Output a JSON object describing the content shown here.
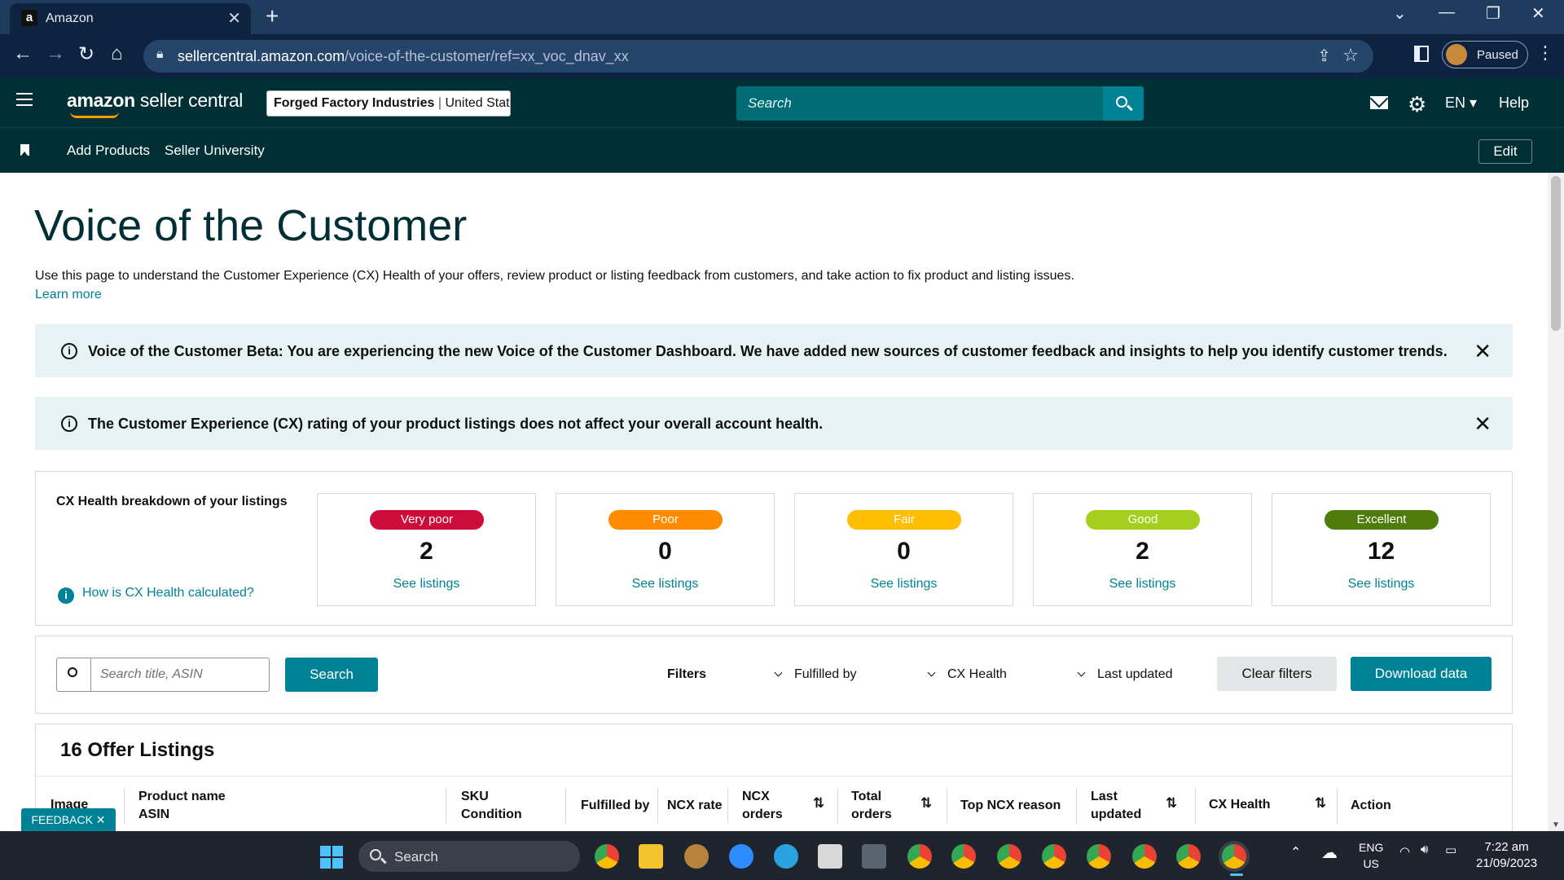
{
  "browser": {
    "tab_title": "Amazon",
    "tab_favicon": "a",
    "url_host": "sellercentral.amazon.com",
    "url_path": "/voice-of-the-customer/ref=xx_voc_dnav_xx",
    "profile_status": "Paused"
  },
  "header": {
    "logo_brand": "amazon",
    "logo_product": " seller central",
    "store_name": "Forged Factory Industries",
    "store_region": "United States",
    "search_placeholder": "Search",
    "language": "EN",
    "help_label": "Help"
  },
  "subnav": {
    "links": [
      "Add Products",
      "Seller University"
    ],
    "edit_label": "Edit"
  },
  "page": {
    "title": "Voice of the Customer",
    "description": "Use this page to understand the Customer Experience (CX) Health of your offers, review product or listing feedback from customers, and take action to fix product and listing issues.",
    "learn_more": "Learn more"
  },
  "alerts": [
    {
      "text": "Voice of the Customer Beta: You are experiencing the new Voice of the Customer Dashboard. We have added new sources of customer feedback and insights to help you identify customer trends."
    },
    {
      "text": "The Customer Experience (CX) rating of your product listings does not affect your overall account health."
    }
  ],
  "cx_health": {
    "title": "CX Health breakdown of your listings",
    "how_link": "How is CX Health calculated?",
    "categories": [
      {
        "label": "Very poor",
        "count": "2",
        "link": "See listings",
        "color": "#cc0c39"
      },
      {
        "label": "Poor",
        "count": "0",
        "link": "See listings",
        "color": "#ff8c00"
      },
      {
        "label": "Fair",
        "count": "0",
        "link": "See listings",
        "color": "#ffbf00"
      },
      {
        "label": "Good",
        "count": "2",
        "link": "See listings",
        "color": "#a5cf1f"
      },
      {
        "label": "Excellent",
        "count": "12",
        "link": "See listings",
        "color": "#4e7d0e"
      }
    ]
  },
  "filters": {
    "search_placeholder": "Search title, ASIN",
    "search_button": "Search",
    "filters_label": "Filters",
    "dropdowns": [
      "Fulfilled by",
      "CX Health",
      "Last updated"
    ],
    "clear_button": "Clear filters",
    "download_button": "Download data"
  },
  "listings": {
    "title": "16 Offer Listings",
    "columns": [
      {
        "line1": "Image",
        "line2": ""
      },
      {
        "line1": "Product name",
        "line2": "ASIN"
      },
      {
        "line1": "SKU",
        "line2": "Condition"
      },
      {
        "line1": "Fulfilled by",
        "line2": ""
      },
      {
        "line1": "NCX rate",
        "line2": ""
      },
      {
        "line1": "NCX",
        "line2": "orders"
      },
      {
        "line1": "Total",
        "line2": "orders"
      },
      {
        "line1": "Top NCX reason",
        "line2": ""
      },
      {
        "line1": "Last",
        "line2": "updated"
      },
      {
        "line1": "CX Health",
        "line2": ""
      },
      {
        "line1": "Action",
        "line2": ""
      }
    ]
  },
  "feedback_label": "FEEDBACK",
  "taskbar": {
    "search_label": "Search",
    "lang_line1": "ENG",
    "lang_line2": "US",
    "time": "7:22 am",
    "date": "21/09/2023"
  },
  "colors": {
    "header_bg": "#002f36",
    "teal_accent": "#008296",
    "alert_bg": "#e6f2f3"
  }
}
